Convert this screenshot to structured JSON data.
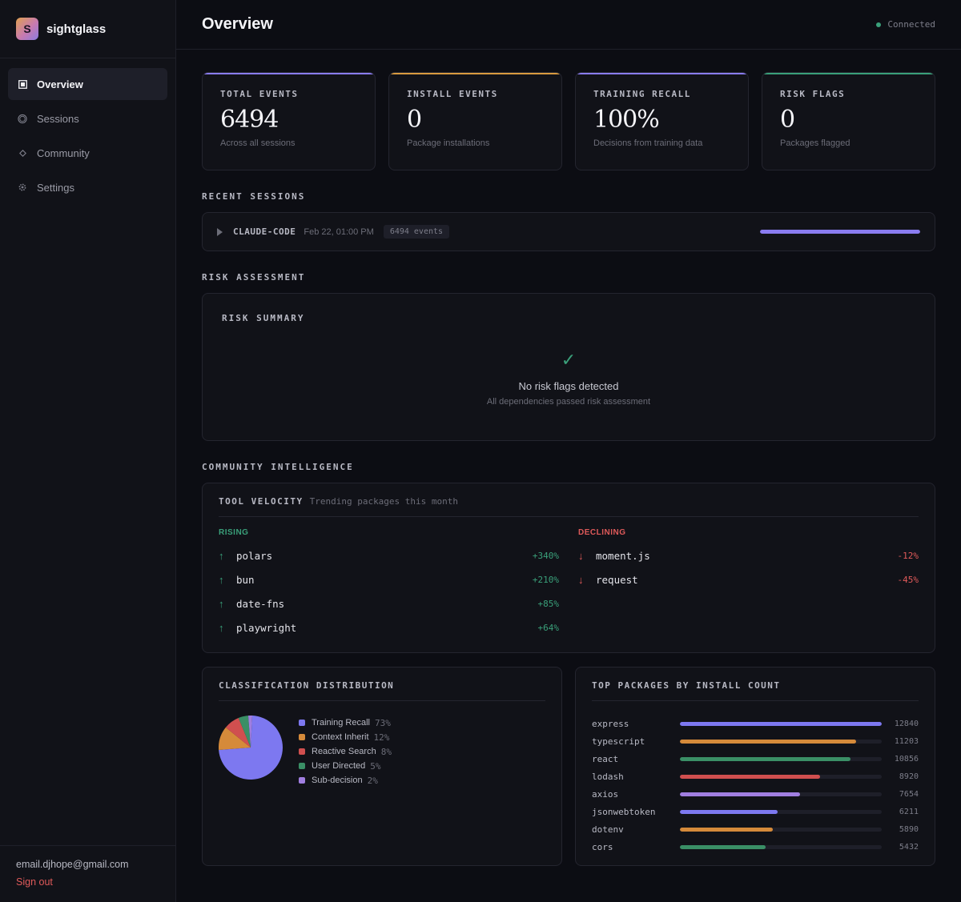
{
  "app": {
    "name": "sightglass",
    "logo_letter": "S"
  },
  "sidebar": {
    "items": [
      {
        "label": "Overview",
        "icon": "square-icon",
        "active": true
      },
      {
        "label": "Sessions",
        "icon": "circle-icon",
        "active": false
      },
      {
        "label": "Community",
        "icon": "diamond-icon",
        "active": false
      },
      {
        "label": "Settings",
        "icon": "gear-icon",
        "active": false
      }
    ],
    "user_email": "email.djhope@gmail.com",
    "signout_label": "Sign out"
  },
  "header": {
    "title": "Overview",
    "status": "Connected",
    "status_color": "#3aa07a"
  },
  "stats": [
    {
      "label": "TOTAL EVENTS",
      "value": "6494",
      "sub": "Across all sessions",
      "accent": "#8a7cf0"
    },
    {
      "label": "INSTALL EVENTS",
      "value": "0",
      "sub": "Package installations",
      "accent": "#d99a3f"
    },
    {
      "label": "TRAINING RECALL",
      "value": "100%",
      "sub": "Decisions from training data",
      "accent": "#8a7cf0"
    },
    {
      "label": "RISK FLAGS",
      "value": "0",
      "sub": "Packages flagged",
      "accent": "#3aa07a"
    }
  ],
  "recent_sessions": {
    "title": "RECENT SESSIONS",
    "items": [
      {
        "name": "CLAUDE-CODE",
        "time": "Feb 22, 01:00 PM",
        "events": "6494 events",
        "progress": 1.0
      }
    ]
  },
  "risk": {
    "section_title": "RISK ASSESSMENT",
    "card_title": "RISK SUMMARY",
    "check_glyph": "✓",
    "message": "No risk flags detected",
    "sub": "All dependencies passed risk assessment"
  },
  "community": {
    "section_title": "COMMUNITY INTELLIGENCE",
    "velocity_title": "TOOL VELOCITY",
    "velocity_sub": "Trending packages this month",
    "rising_label": "RISING",
    "declining_label": "DECLINING",
    "rising": [
      {
        "name": "polars",
        "pct": "+340%"
      },
      {
        "name": "bun",
        "pct": "+210%"
      },
      {
        "name": "date-fns",
        "pct": "+85%"
      },
      {
        "name": "playwright",
        "pct": "+64%"
      }
    ],
    "declining": [
      {
        "name": "moment.js",
        "pct": "-12%"
      },
      {
        "name": "request",
        "pct": "-45%"
      }
    ],
    "rising_color": "#3aa07a",
    "declining_color": "#e05a5a"
  },
  "distribution": {
    "title": "CLASSIFICATION DISTRIBUTION",
    "items": [
      {
        "label": "Training Recall",
        "pct": "73%",
        "value": 73,
        "color": "#7d78f0"
      },
      {
        "label": "Context Inherit",
        "pct": "12%",
        "value": 12,
        "color": "#d58a3a"
      },
      {
        "label": "Reactive Search",
        "pct": "8%",
        "value": 8,
        "color": "#d04f4f"
      },
      {
        "label": "User Directed",
        "pct": "5%",
        "value": 5,
        "color": "#3a8f66"
      },
      {
        "label": "Sub-decision",
        "pct": "2%",
        "value": 2,
        "color": "#a07ee0"
      }
    ]
  },
  "top_packages": {
    "title": "TOP PACKAGES BY INSTALL COUNT",
    "max": 12840,
    "items": [
      {
        "name": "express",
        "count": 12840,
        "color": "#7d78f0"
      },
      {
        "name": "typescript",
        "count": 11203,
        "color": "#d58a3a"
      },
      {
        "name": "react",
        "count": 10856,
        "color": "#3a8f66"
      },
      {
        "name": "lodash",
        "count": 8920,
        "color": "#d04f4f"
      },
      {
        "name": "axios",
        "count": 7654,
        "color": "#a07ee0"
      },
      {
        "name": "jsonwebtoken",
        "count": 6211,
        "color": "#7d78f0"
      },
      {
        "name": "dotenv",
        "count": 5890,
        "color": "#d58a3a"
      },
      {
        "name": "cors",
        "count": 5432,
        "color": "#3a8f66"
      }
    ]
  }
}
